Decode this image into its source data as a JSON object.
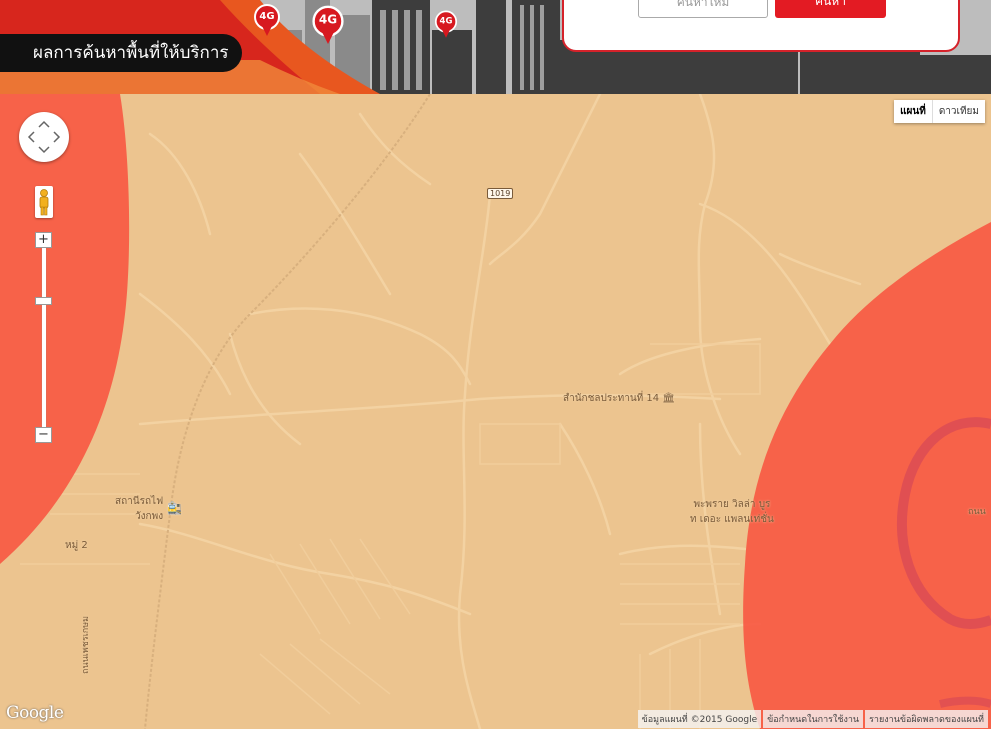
{
  "banner": {
    "title": "ผลการค้นหาพื้นที่ให้บริการ",
    "secondary_button": "ค้นหาใหม่",
    "primary_button": "ค้นหา",
    "pins": [
      "4G",
      "4G",
      "4G"
    ]
  },
  "map": {
    "map_type": [
      "แผนที่",
      "ดาวเทียม"
    ],
    "active_map_type": "แผนที่",
    "controls": {
      "pan": "pan-control",
      "zoom_in": "+",
      "zoom_out": "−",
      "street_view": "pegman-icon"
    },
    "route_shield": "1019",
    "labels": {
      "office": "สำนักชลประทานที่ 14",
      "station_line1": "สถานีรถไฟ",
      "station_line2": "วังกพง",
      "village": "หมู่ 2",
      "housing_line1": "พะพราย วิลล่า บูร",
      "housing_line2": "ท เดอะ แพลนเท่ชั่น",
      "road_left": "ถนนเพชรเกษม",
      "road_right": "ถนน"
    },
    "logo": "Google",
    "attribution": [
      "ข้อมูลแผนที่ ©2015 Google",
      "ข้อกำหนดในการใช้งาน",
      "รายงานข้อผิดพลาดของแผนที่"
    ],
    "coverage_color": "#f85a44",
    "base_color": "#ecc48f"
  }
}
